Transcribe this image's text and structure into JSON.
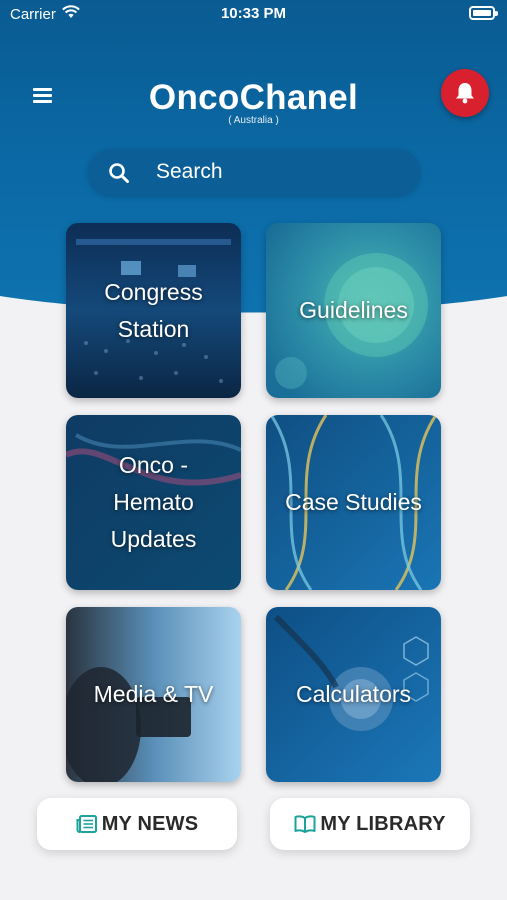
{
  "status_bar": {
    "carrier": "Carrier",
    "time": "10:33 PM"
  },
  "header": {
    "title": "OncoChanel",
    "subtitle": "( Australia )",
    "menu_icon": "hamburger-menu-icon",
    "notification_icon": "bell-icon"
  },
  "search": {
    "placeholder": "Search",
    "icon": "search-icon"
  },
  "tiles": [
    {
      "label": "Congress\nStation"
    },
    {
      "label": "Guidelines"
    },
    {
      "label": "Onco -\nHemato\nUpdates"
    },
    {
      "label": "Case Studies"
    },
    {
      "label": "Media & TV"
    },
    {
      "label": "Calculators"
    }
  ],
  "bottom": {
    "news_label": "MY NEWS",
    "library_label": "MY LIBRARY",
    "news_icon": "newspaper-icon",
    "library_icon": "open-book-icon"
  },
  "colors": {
    "header_blue": "#0b6aa6",
    "bell_red": "#d8202e",
    "icon_teal": "#1aa39a",
    "background": "#f2f2f4"
  }
}
